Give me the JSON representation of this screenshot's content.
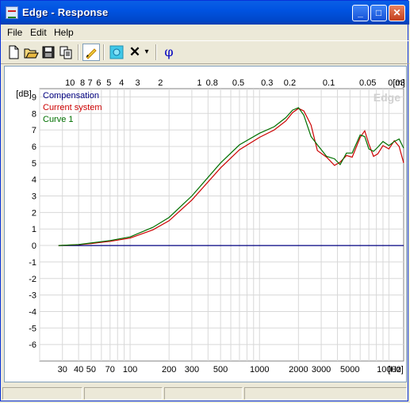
{
  "window": {
    "title": "Edge - Response",
    "min_glyph": "_",
    "max_glyph": "□",
    "close_glyph": "✕"
  },
  "menu": {
    "file": "File",
    "edit": "Edit",
    "help": "Help"
  },
  "toolbar": {
    "buttons": [
      "new-icon",
      "open-icon",
      "save-icon",
      "copy-icon",
      "pencil-icon",
      "speaker-icon",
      "delete-icon",
      "dropdown-icon",
      "phase-icon"
    ],
    "phase_glyph": "φ",
    "delete_glyph": "✕",
    "dropdown_glyph": "▾"
  },
  "chart_data": {
    "type": "line",
    "watermark": "Edge",
    "ylabel": "[dB]",
    "xlabel": "[Hz]",
    "top_unit": "[m]",
    "x_scale": "log",
    "xlim": [
      20,
      13000
    ],
    "ylim": [
      -7,
      9.5
    ],
    "x_ticks": [
      30,
      40,
      50,
      70,
      100,
      200,
      300,
      500,
      1000,
      2000,
      3000,
      5000,
      10000
    ],
    "x_tick_labels": [
      "30",
      "40",
      "50",
      "70",
      "100",
      "200",
      "300",
      "500",
      "1000",
      "2000",
      "3000",
      "5000",
      "10000"
    ],
    "y_ticks": [
      9,
      8,
      7,
      6,
      5,
      4,
      3,
      2,
      1,
      0,
      -1,
      -2,
      -3,
      -4,
      -5,
      -6
    ],
    "y_tick_labels": [
      "9",
      "8",
      "7",
      "6",
      "5",
      "4",
      "3",
      "2",
      "1",
      "0",
      "-1",
      "-2",
      "-3",
      "-4",
      "-5",
      "-6"
    ],
    "top_ticks": [
      10,
      8,
      7,
      6,
      5,
      4,
      3,
      2,
      1,
      0.8,
      0.5,
      0.3,
      0.2,
      0.1,
      0.05,
      0.03
    ],
    "top_tick_labels": [
      "10",
      "8",
      "7",
      "6",
      "5",
      "4",
      "3",
      "2",
      "1",
      "0.8",
      "0.5",
      "0.3",
      "0.2",
      "0.1",
      "0.05",
      "0.03"
    ],
    "legend_position": "top-left",
    "grid": true,
    "series": [
      {
        "name": "Compensation",
        "color": "#000080",
        "x": [
          28,
          13000
        ],
        "y": [
          0,
          0
        ]
      },
      {
        "name": "Current system",
        "color": "#cc0000",
        "x": [
          28,
          40,
          50,
          70,
          100,
          150,
          200,
          300,
          500,
          700,
          1000,
          1300,
          1600,
          1800,
          2000,
          2200,
          2500,
          2800,
          3300,
          3800,
          4200,
          4700,
          5200,
          6000,
          6500,
          7000,
          7600,
          8200,
          9000,
          10000,
          11000,
          12000,
          13000
        ],
        "y": [
          0,
          0.05,
          0.12,
          0.25,
          0.45,
          0.95,
          1.5,
          2.75,
          4.7,
          5.8,
          6.55,
          7.0,
          7.55,
          8.05,
          8.3,
          8.15,
          7.3,
          5.75,
          5.35,
          4.85,
          5.05,
          5.45,
          5.35,
          6.55,
          6.95,
          6.15,
          5.4,
          5.55,
          6.05,
          5.85,
          6.35,
          6.0,
          5.0
        ]
      },
      {
        "name": "Curve 1",
        "color": "#007000",
        "x": [
          28,
          40,
          50,
          70,
          100,
          150,
          200,
          300,
          500,
          700,
          1000,
          1300,
          1600,
          1800,
          2000,
          2200,
          2500,
          2800,
          3300,
          3800,
          4200,
          4700,
          5200,
          6000,
          6500,
          7000,
          7600,
          8200,
          9000,
          10000,
          11000,
          12000,
          13000
        ],
        "y": [
          0,
          0.06,
          0.15,
          0.3,
          0.52,
          1.1,
          1.7,
          3.0,
          5.0,
          6.1,
          6.8,
          7.2,
          7.75,
          8.2,
          8.35,
          7.9,
          6.6,
          6.1,
          5.4,
          5.25,
          4.9,
          5.6,
          5.6,
          6.7,
          6.6,
          5.85,
          5.7,
          5.95,
          6.3,
          6.05,
          6.3,
          6.45,
          5.9
        ]
      }
    ]
  }
}
